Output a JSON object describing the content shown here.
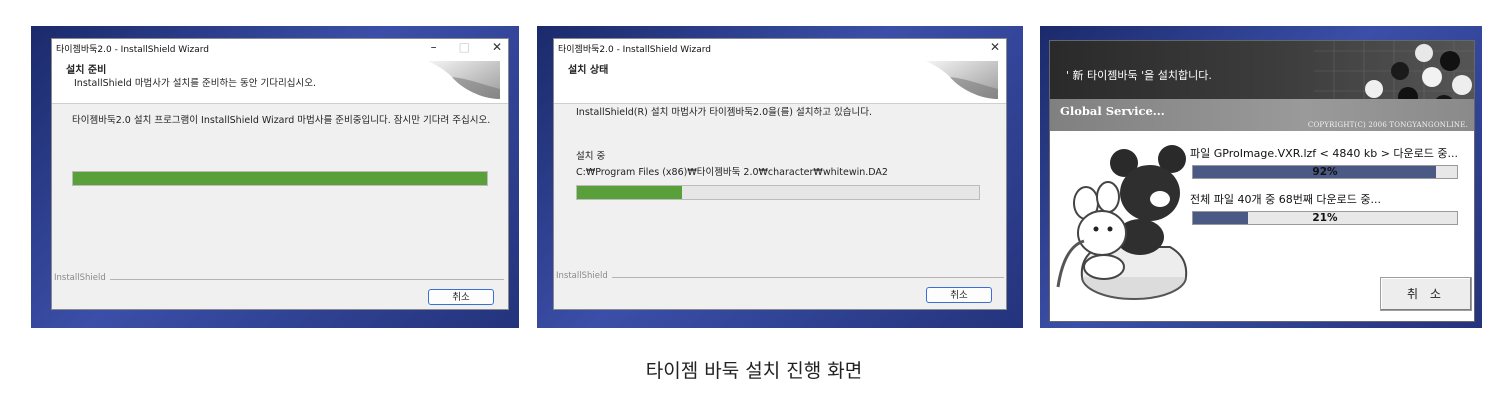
{
  "panel1": {
    "title": "타이젬바둑2.0 - InstallShield Wizard",
    "header_title": "설치 준비",
    "header_subtitle": "InstallShield 마법사가 설치를 준비하는 동안 기다리십시오.",
    "body_text": "타이젬바둑2.0 설치 프로그램이 InstallShield Wizard 마법사를 준비중입니다. 잠시만 기다려 주십시오.",
    "progress": 1.0,
    "footer_label": "InstallShield",
    "cancel_label": "취소",
    "window_buttons": [
      "–",
      "□",
      "✕"
    ]
  },
  "panel2": {
    "title": "타이젬바둑2.0 - InstallShield Wizard",
    "header_title": "설치 상태",
    "body_text": "InstallShield(R) 설치 마법사가 타이젬바둑2.0을(를) 설치하고 있습니다.",
    "status_label": "설치 중",
    "file_path": "C:₩Program Files (x86)₩타이젬바둑 2.0₩character₩whitewin.DA2",
    "progress": 0.26,
    "footer_label": "InstallShield",
    "cancel_label": "취소",
    "close_button": "✕"
  },
  "panel3": {
    "heading": "' 新 타이젬바둑 '을 설치합니다.",
    "service_label": "Global Service...",
    "copyright": "COPYRIGHT(C) 2006 TONGYANGONLINE.",
    "file_line": "파일 GProImage.VXR.lzf < 4840 kb > 다운로드 중...",
    "file_progress_label": "92%",
    "file_progress": 0.92,
    "total_line": "전체 파일 40개 중  68번째 다운로드 중...",
    "total_progress_label": "21%",
    "total_progress": 0.21,
    "cancel_label": "취 소"
  },
  "caption": "타이젬 바둑 설치 진행 화면",
  "colors": {
    "bg_blue": "#24337c",
    "green_progress": "#5aa03a",
    "navy_progress": "#4a5a85"
  }
}
